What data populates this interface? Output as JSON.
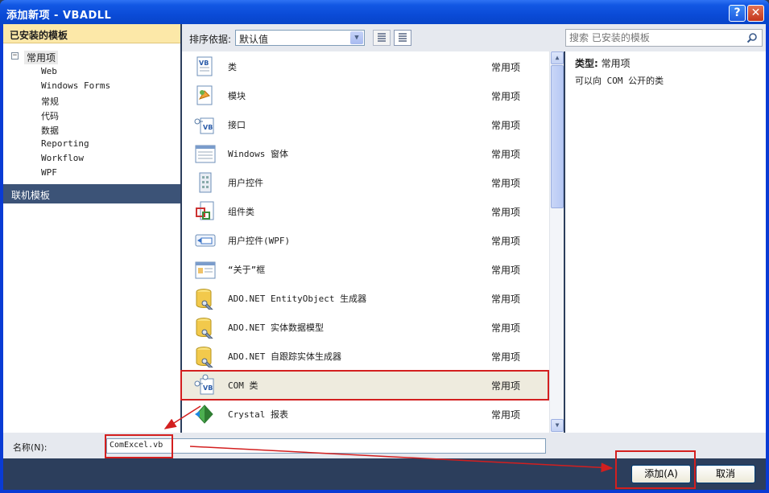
{
  "window": {
    "title": "添加新项 - VBADLL",
    "help_button": "?",
    "close_button": "✕"
  },
  "sidebar": {
    "installed_header": "已安装的模板",
    "tree_toggle": "⊟",
    "tree_root": "常用项",
    "tree_children": [
      "Web",
      "Windows Forms",
      "常规",
      "代码",
      "数据",
      "Reporting",
      "Workflow",
      "WPF"
    ],
    "online_header": "联机模板"
  },
  "toolbar": {
    "sort_label": "排序依据:",
    "sort_value": "默认值",
    "search_placeholder": "搜索 已安装的模板"
  },
  "items": [
    {
      "name": "类",
      "category": "常用项",
      "icon": "vb-class-icon"
    },
    {
      "name": "模块",
      "category": "常用项",
      "icon": "module-icon"
    },
    {
      "name": "接口",
      "category": "常用项",
      "icon": "interface-icon"
    },
    {
      "name": "Windows 窗体",
      "category": "常用项",
      "icon": "windows-form-icon"
    },
    {
      "name": "用户控件",
      "category": "常用项",
      "icon": "user-control-icon"
    },
    {
      "name": "组件类",
      "category": "常用项",
      "icon": "component-class-icon"
    },
    {
      "name": "用户控件(WPF)",
      "category": "常用项",
      "icon": "wpf-user-control-icon"
    },
    {
      "name": "“关于”框",
      "category": "常用项",
      "icon": "about-box-icon"
    },
    {
      "name": "ADO.NET EntityObject 生成器",
      "category": "常用项",
      "icon": "database-icon"
    },
    {
      "name": "ADO.NET 实体数据模型",
      "category": "常用项",
      "icon": "database-icon"
    },
    {
      "name": "ADO.NET 自跟踪实体生成器",
      "category": "常用项",
      "icon": "database-icon"
    },
    {
      "name": "COM 类",
      "category": "常用项",
      "icon": "com-class-icon"
    },
    {
      "name": "Crystal 报表",
      "category": "常用项",
      "icon": "crystal-report-icon"
    }
  ],
  "selected_index": 11,
  "detail": {
    "type_label": "类型:",
    "type_value": "常用项",
    "description": "可以向 COM 公开的类"
  },
  "name_field": {
    "label": "名称(N):",
    "value": "ComExcel.vb"
  },
  "buttons": {
    "add": "添加(A)",
    "cancel": "取消"
  },
  "colors": {
    "title_bar": "#0a4ad6",
    "installed_header": "#fce8a8",
    "online_header": "#3c5377",
    "selected_row": "#eeebde",
    "annotation_red": "#d31f1f"
  }
}
